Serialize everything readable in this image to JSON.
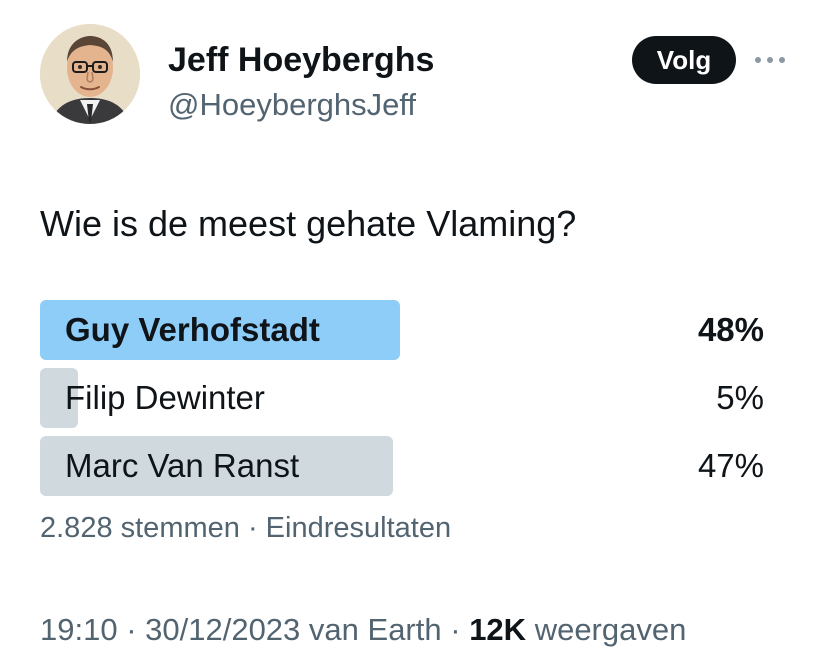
{
  "author": {
    "name": "Jeff Hoeyberghs",
    "handle": "@HoeyberghsJeff",
    "follow_label": "Volg",
    "more_icon": "more-horizontal-icon"
  },
  "tweet": {
    "text": "Wie is de meest gehate Vlaming?"
  },
  "poll": {
    "options": [
      {
        "label": "Guy Verhofstadt",
        "percent_label": "48%",
        "percent": 48,
        "winner": true
      },
      {
        "label": "Filip Dewinter",
        "percent_label": "5%",
        "percent": 5,
        "winner": false
      },
      {
        "label": "Marc Van Ranst",
        "percent_label": "47%",
        "percent": 47,
        "winner": false
      }
    ],
    "votes_label": "2.828 stemmen",
    "separator": " · ",
    "status_label": "Eindresultaten",
    "colors": {
      "winner_bar": "#8ecdf8",
      "other_bar": "#cfd9de"
    }
  },
  "meta": {
    "time": "19:10",
    "date": "30/12/2023",
    "source": "van Earth",
    "separator": " · ",
    "views_count": "12K",
    "views_label": "weergaven"
  },
  "colors": {
    "text": "#0f1419",
    "secondary": "#536471",
    "button_bg": "#0f1419"
  }
}
